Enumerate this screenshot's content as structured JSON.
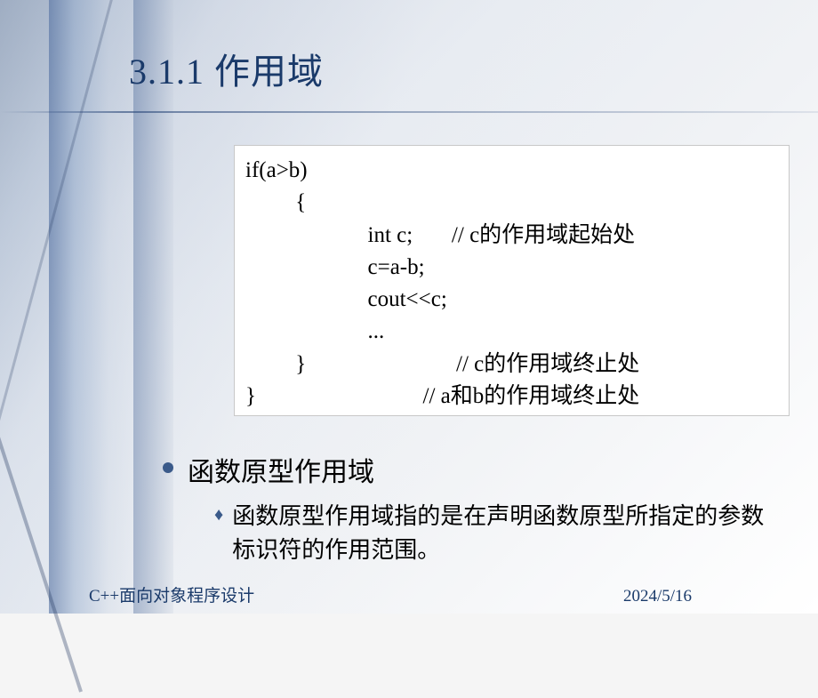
{
  "header": {
    "title": "3.1.1 作用域"
  },
  "code": {
    "lines": [
      "if(a>b)",
      "         {",
      "                      int c;       // c的作用域起始处",
      "                      c=a-b;",
      "                      cout<<c;",
      "                      ...",
      "         }                           // c的作用域终止处",
      "}                              // a和b的作用域终止处"
    ]
  },
  "bullets": {
    "level1": "函数原型作用域",
    "level2": "函数原型作用域指的是在声明函数原型所指定的参数标识符的作用范围。"
  },
  "footer": {
    "left": "C++面向对象程序设计",
    "right": "2024/5/16"
  }
}
